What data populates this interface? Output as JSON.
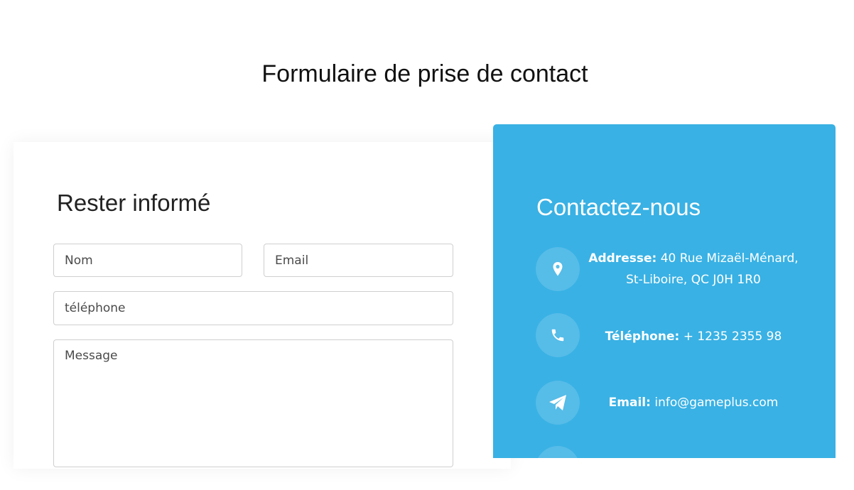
{
  "page": {
    "title": "Formulaire de prise de contact"
  },
  "form": {
    "heading": "Rester informé",
    "name_placeholder": "Nom",
    "email_placeholder": "Email",
    "phone_placeholder": "téléphone",
    "message_placeholder": "Message"
  },
  "contact": {
    "heading": "Contactez-nous",
    "accent_color": "#39b1e4",
    "items": [
      {
        "icon": "map-pin-icon",
        "label": "Addresse:",
        "value": "40 Rue Mizaël-Ménard, St-Liboire, QC J0H 1R0"
      },
      {
        "icon": "phone-icon",
        "label": "Téléphone:",
        "value": "+ 1235 2355 98"
      },
      {
        "icon": "paper-plane-icon",
        "label": "Email:",
        "value": "info@gameplus.com"
      }
    ]
  }
}
